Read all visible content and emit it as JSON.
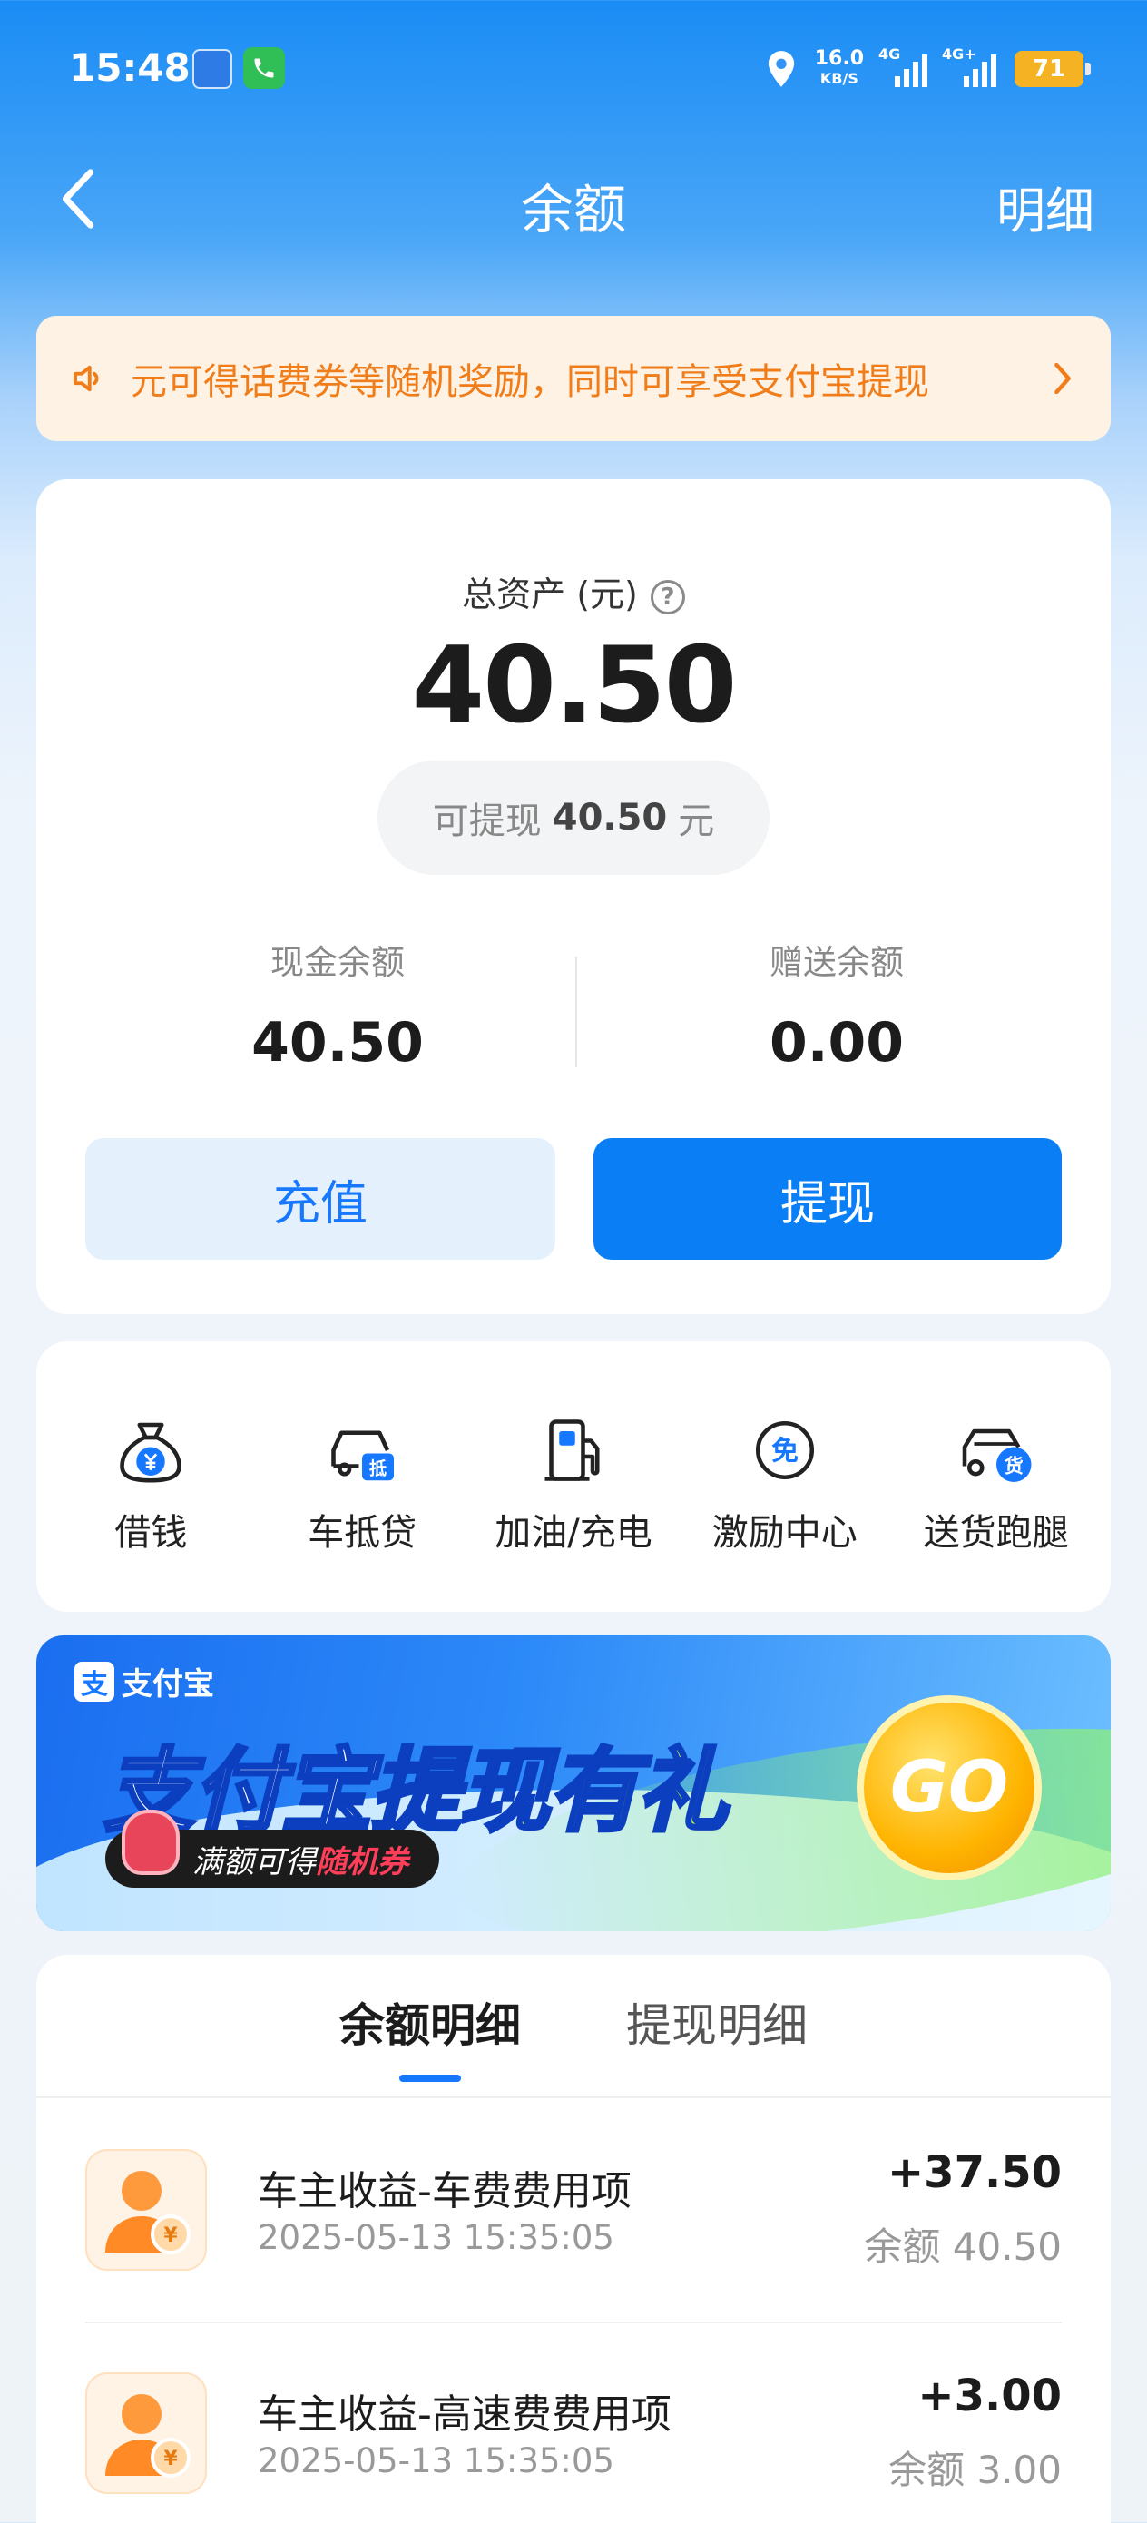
{
  "status_bar": {
    "time": "15:48",
    "net_speed_value": "16.0",
    "net_speed_unit": "KB/S",
    "sim1_label": "4G",
    "sim2_label": "4G+",
    "battery": "71"
  },
  "nav": {
    "title": "余额",
    "detail_link": "明细"
  },
  "notice": {
    "text": "元可得话费券等随机奖励，同时可享受支付宝提现"
  },
  "balance": {
    "total_label": "总资产 (元)",
    "total_value": "40.50",
    "withdrawable_prefix": "可提现",
    "withdrawable_amount": "40.50",
    "withdrawable_suffix": "元",
    "cash_label": "现金余额",
    "cash_value": "40.50",
    "gift_label": "赠送余额",
    "gift_value": "0.00",
    "recharge_button": "充值",
    "withdraw_button": "提现"
  },
  "services": [
    {
      "label": "借钱",
      "icon": "money-bag-icon"
    },
    {
      "label": "车抵贷",
      "icon": "car-loan-icon"
    },
    {
      "label": "加油/充电",
      "icon": "fuel-pump-icon"
    },
    {
      "label": "激励中心",
      "icon": "free-badge-icon"
    },
    {
      "label": "送货跑腿",
      "icon": "delivery-truck-icon"
    }
  ],
  "promo": {
    "brand": "支付宝",
    "title_part1": "支付宝",
    "title_part2": "提现有礼",
    "tag_prefix": "满额可得",
    "tag_highlight": "随机券",
    "go_button": "GO"
  },
  "records": {
    "tabs": [
      "余额明细",
      "提现明细"
    ],
    "active_tab": 0,
    "items": [
      {
        "title": "车主收益-车费费用项",
        "time": "2025-05-13 15:35:05",
        "amount": "+37.50",
        "balance": "余额 40.50"
      },
      {
        "title": "车主收益-高速费费用项",
        "time": "2025-05-13 15:35:05",
        "amount": "+3.00",
        "balance": "余额 3.00"
      }
    ]
  },
  "colors": {
    "primary_blue": "#0a7ff5",
    "notice_orange": "#f07c1a",
    "notice_bg": "#fdf2e3"
  }
}
